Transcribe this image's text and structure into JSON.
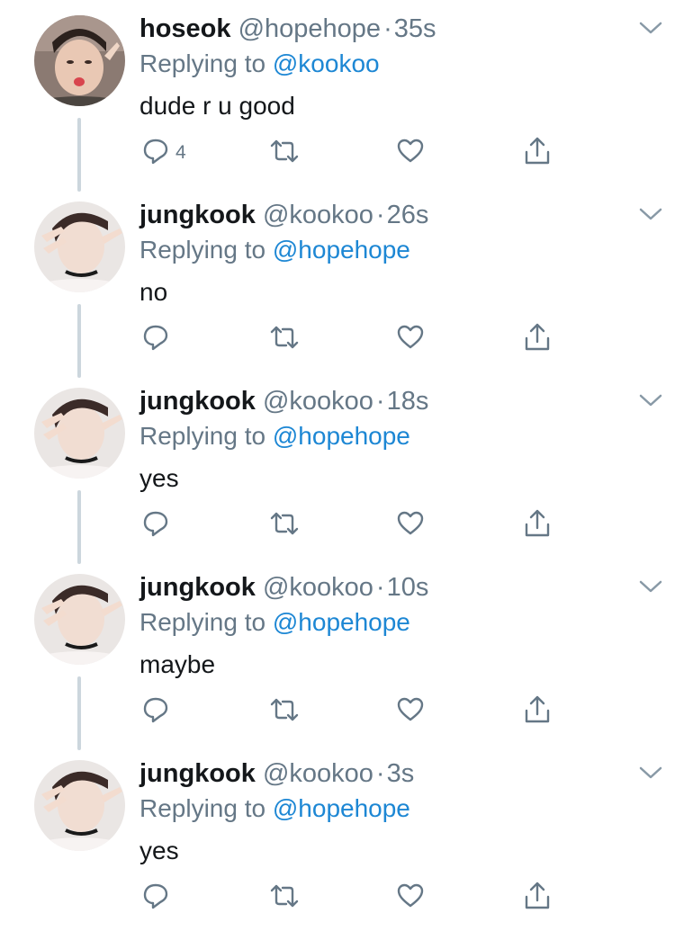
{
  "colors": {
    "name": "#14171a",
    "meta": "#657786",
    "mention": "#1d87d4",
    "icon": "#657786",
    "thread_line": "#ccd6dd"
  },
  "tweets": [
    {
      "name": "hoseok",
      "handle": "@hopehope",
      "dot": "·",
      "time": "35s",
      "replying_prefix": "Replying to",
      "replying_to": "@kookoo",
      "text": "dude r u good",
      "reply_count": "4",
      "avatar": "avatar-hoseok"
    },
    {
      "name": "jungkook",
      "handle": "@kookoo",
      "dot": "·",
      "time": "26s",
      "replying_prefix": "Replying to",
      "replying_to": "@hopehope",
      "text": "no",
      "reply_count": "",
      "avatar": "avatar-jungkook"
    },
    {
      "name": "jungkook",
      "handle": "@kookoo",
      "dot": "·",
      "time": "18s",
      "replying_prefix": "Replying to",
      "replying_to": "@hopehope",
      "text": "yes",
      "reply_count": "",
      "avatar": "avatar-jungkook"
    },
    {
      "name": "jungkook",
      "handle": "@kookoo",
      "dot": "·",
      "time": "10s",
      "replying_prefix": "Replying to",
      "replying_to": "@hopehope",
      "text": "maybe",
      "reply_count": "",
      "avatar": "avatar-jungkook"
    },
    {
      "name": "jungkook",
      "handle": "@kookoo",
      "dot": "·",
      "time": "3s",
      "replying_prefix": "Replying to",
      "replying_to": "@hopehope",
      "text": "yes",
      "reply_count": "",
      "avatar": "avatar-jungkook"
    }
  ],
  "icons": {
    "reply": "reply-icon",
    "retweet": "retweet-icon",
    "like": "heart-icon",
    "share": "share-icon",
    "more": "chevron-down-icon"
  }
}
